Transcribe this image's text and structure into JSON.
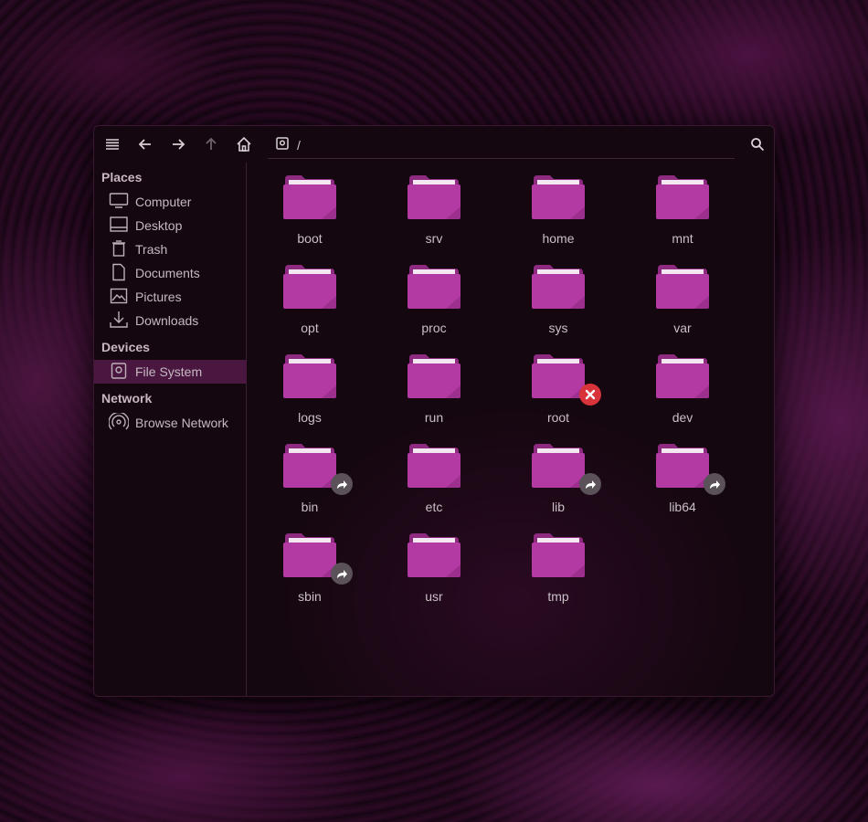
{
  "toolbar": {
    "menu_icon": "hamburger-menu-icon",
    "back_icon": "arrow-left-icon",
    "forward_icon": "arrow-right-icon",
    "up_icon": "arrow-up-icon",
    "home_icon": "home-icon",
    "search_icon": "search-icon"
  },
  "pathbar": {
    "path": "/",
    "drive_icon": "drive-icon"
  },
  "sidebar": {
    "places_title": "Places",
    "places": [
      {
        "label": "Computer",
        "icon": "monitor-icon"
      },
      {
        "label": "Desktop",
        "icon": "desktop-icon"
      },
      {
        "label": "Trash",
        "icon": "trash-icon"
      },
      {
        "label": "Documents",
        "icon": "document-icon"
      },
      {
        "label": "Pictures",
        "icon": "picture-icon"
      },
      {
        "label": "Downloads",
        "icon": "download-icon"
      }
    ],
    "devices_title": "Devices",
    "devices": [
      {
        "label": "File System",
        "icon": "drive-icon",
        "active": true
      }
    ],
    "network_title": "Network",
    "network": [
      {
        "label": "Browse Network",
        "icon": "network-icon"
      }
    ]
  },
  "files": [
    {
      "name": "boot",
      "emblem": ""
    },
    {
      "name": "srv",
      "emblem": ""
    },
    {
      "name": "home",
      "emblem": ""
    },
    {
      "name": "mnt",
      "emblem": ""
    },
    {
      "name": "opt",
      "emblem": ""
    },
    {
      "name": "proc",
      "emblem": ""
    },
    {
      "name": "sys",
      "emblem": ""
    },
    {
      "name": "var",
      "emblem": ""
    },
    {
      "name": "logs",
      "emblem": ""
    },
    {
      "name": "run",
      "emblem": ""
    },
    {
      "name": "root",
      "emblem": "no-access"
    },
    {
      "name": "dev",
      "emblem": ""
    },
    {
      "name": "bin",
      "emblem": "link"
    },
    {
      "name": "etc",
      "emblem": ""
    },
    {
      "name": "lib",
      "emblem": "link"
    },
    {
      "name": "lib64",
      "emblem": "link"
    },
    {
      "name": "sbin",
      "emblem": "link"
    },
    {
      "name": "usr",
      "emblem": ""
    },
    {
      "name": "tmp",
      "emblem": ""
    }
  ],
  "colors": {
    "folder": "#b43aa3",
    "folder_dark": "#8e2a80",
    "accent": "#4a1740",
    "text": "#c9bfc5"
  }
}
